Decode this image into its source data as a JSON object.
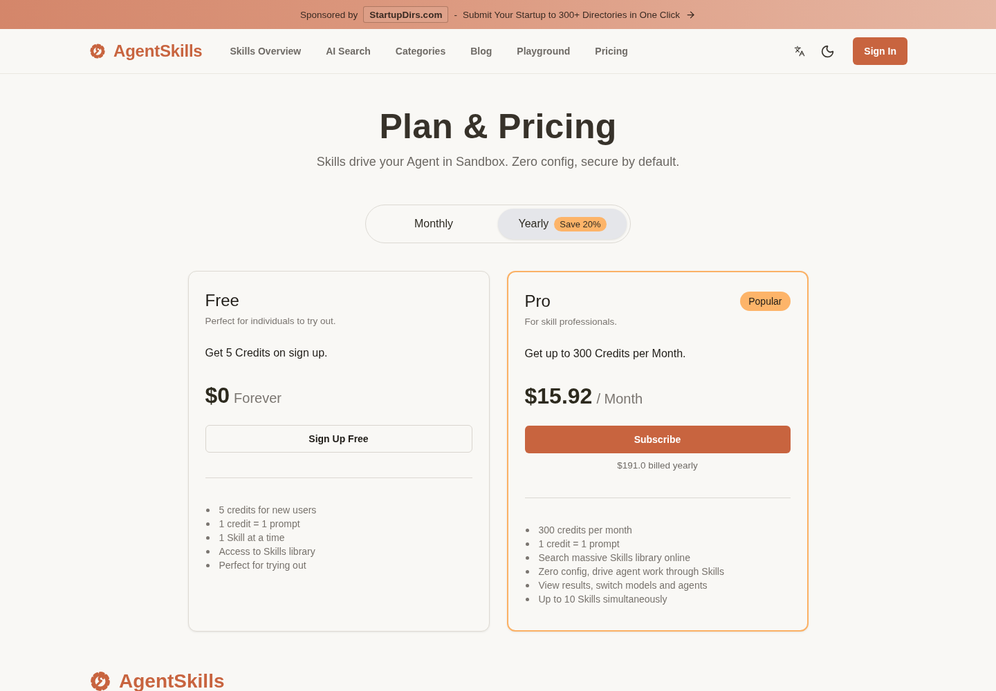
{
  "banner": {
    "sponsored_label": "Sponsored by",
    "sponsor": "StartupDirs.com",
    "separator": "-",
    "message": "Submit Your Startup to 300+ Directories in One Click"
  },
  "header": {
    "brand": "AgentSkills",
    "nav": [
      "Skills Overview",
      "AI Search",
      "Categories",
      "Blog",
      "Playground",
      "Pricing"
    ],
    "sign_in": "Sign In"
  },
  "hero": {
    "title": "Plan & Pricing",
    "subtitle": "Skills drive your Agent in Sandbox. Zero config, secure by default."
  },
  "billing_toggle": [
    {
      "label": "Monthly",
      "selected": false
    },
    {
      "label": "Yearly",
      "selected": true,
      "badge": "Save 20%"
    }
  ],
  "plans": [
    {
      "name": "Free",
      "highlighted": false,
      "description": "Perfect for individuals to try out.",
      "credits": "Get 5 Credits on sign up.",
      "price": "$0",
      "period": "Forever",
      "button": {
        "label": "Sign Up Free",
        "kind": "outline"
      },
      "features": [
        "5 credits for new users",
        "1 credit = 1 prompt",
        "1 Skill at a time",
        "Access to Skills library",
        "Perfect for trying out"
      ]
    },
    {
      "name": "Pro",
      "badge": "Popular",
      "highlighted": true,
      "description": "For skill professionals.",
      "credits": "Get up to 300 Credits per Month.",
      "price": "$15.92",
      "period": "/ Month",
      "button": {
        "label": "Subscribe",
        "kind": "primary"
      },
      "billing_note": "$191.0 billed yearly",
      "features": [
        "300 credits per month",
        "1 credit = 1 prompt",
        "Search massive Skills library online",
        "Zero config, drive agent work through Skills",
        "View results, switch models and agents",
        "Up to 10 Skills simultaneously"
      ]
    }
  ],
  "footer": {
    "brand": "AgentSkills"
  }
}
